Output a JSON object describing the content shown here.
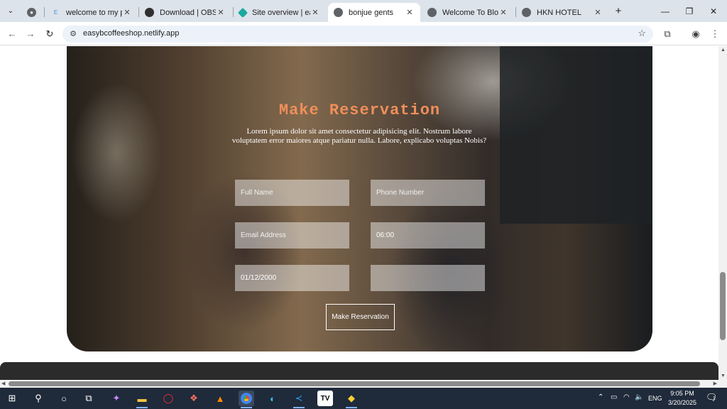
{
  "browser": {
    "tabs": [
      {
        "title": "",
        "fav_color": "#5f6368"
      },
      {
        "title": "welcome to my pro",
        "fav_color": "#4a90d9",
        "fav_text": "E"
      },
      {
        "title": "Download | OBS",
        "fav_color": "#303030"
      },
      {
        "title": "Site overview | easy",
        "fav_color": "#1aa9a0"
      },
      {
        "title": "bonjue gents",
        "fav_color": "#5f6368",
        "active": true
      },
      {
        "title": "Welcome To Bloem",
        "fav_color": "#5f6368"
      },
      {
        "title": "HKN HOTEL",
        "fav_color": "#5f6368"
      }
    ],
    "close_glyph": "✕",
    "new_tab_glyph": "+",
    "url": "easybcoffeeshop.netlify.app"
  },
  "reservation": {
    "title": "Make Reservation",
    "description": "Lorem ipsum dolor sit amet consectetur adipisicing elit. Nostrum labore voluptatem error maiores atque pariatur nulla. Labore, explicabo voluptas Nobis?",
    "fields": {
      "full_name_placeholder": "Full Name",
      "phone_placeholder": "Phone Number",
      "email_placeholder": "Email Address",
      "time_value": "06:00",
      "date_value": "01/12/2000",
      "extra_value": ""
    },
    "submit_label": "Make Reservation"
  },
  "taskbar": {
    "language": "ENG",
    "time": "9:05 PM",
    "date": "3/20/2025",
    "notification_count": "1"
  },
  "colors": {
    "accent": "#f08f5a",
    "taskbar": "#1f2a3a",
    "tabstrip": "#dde3ea"
  }
}
